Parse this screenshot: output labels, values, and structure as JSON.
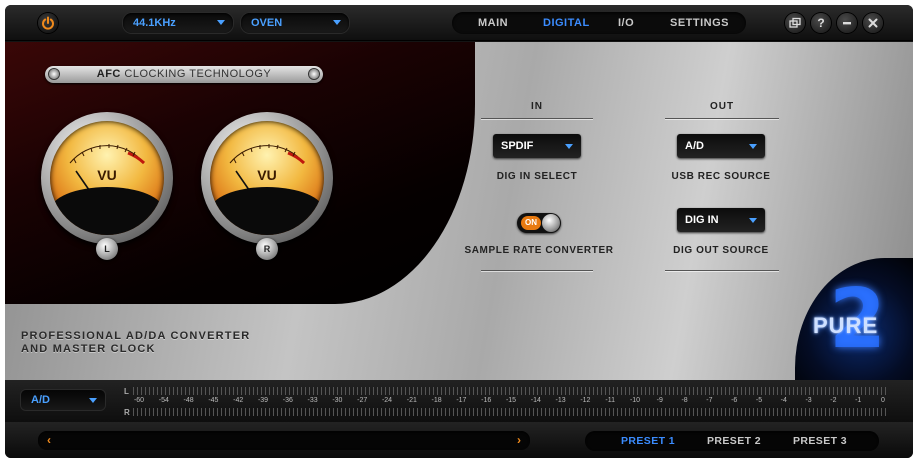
{
  "topbar": {
    "power_icon": "power-icon",
    "sample_rate": "44.1KHz",
    "clock_source": "OVEN",
    "tabs": [
      {
        "label": "MAIN",
        "active": false
      },
      {
        "label": "DIGITAL",
        "active": true
      },
      {
        "label": "I/O",
        "active": false
      },
      {
        "label": "SETTINGS",
        "active": false
      }
    ],
    "window_buttons": [
      "restore-icon",
      "help-icon",
      "minimize-icon",
      "close-icon"
    ],
    "help_glyph": "?"
  },
  "left_panel": {
    "afc_label_bold": "AFC",
    "afc_label_rest": "CLOCKING TECHNOLOGY",
    "meters": [
      {
        "label": "VU",
        "channel": "L"
      },
      {
        "label": "VU",
        "channel": "R"
      }
    ],
    "product_line1": "PROFESSIONAL AD/DA CONVERTER",
    "product_line2": "AND MASTER CLOCK"
  },
  "digital": {
    "in_header": "IN",
    "out_header": "OUT",
    "dig_in_select": {
      "value": "SPDIF",
      "label": "DIG IN SELECT"
    },
    "usb_rec_source": {
      "value": "A/D",
      "label": "USB REC SOURCE"
    },
    "src": {
      "state": "ON",
      "label": "SAMPLE RATE CONVERTER"
    },
    "dig_out_source": {
      "value": "DIG IN",
      "label": "DIG OUT SOURCE"
    }
  },
  "logo": {
    "text": "PURE",
    "number": "2"
  },
  "level": {
    "source": "A/D",
    "channels": [
      "L",
      "R"
    ],
    "scale": [
      "-60",
      "-54",
      "-48",
      "-45",
      "-42",
      "-39",
      "-36",
      "-33",
      "-30",
      "-27",
      "-24",
      "-21",
      "-18",
      "-17",
      "-16",
      "-15",
      "-14",
      "-13",
      "-12",
      "-11",
      "-10",
      "-9",
      "-8",
      "-7",
      "-6",
      "-5",
      "-4",
      "-3",
      "-2",
      "-1",
      "0"
    ]
  },
  "bottom": {
    "prev_glyph": "‹",
    "next_glyph": "›",
    "presets": [
      {
        "label": "PRESET 1",
        "active": true
      },
      {
        "label": "PRESET 2",
        "active": false
      },
      {
        "label": "PRESET 3",
        "active": false
      }
    ]
  },
  "colors": {
    "accent_blue": "#3b8cff",
    "accent_orange": "#f08a1c"
  }
}
